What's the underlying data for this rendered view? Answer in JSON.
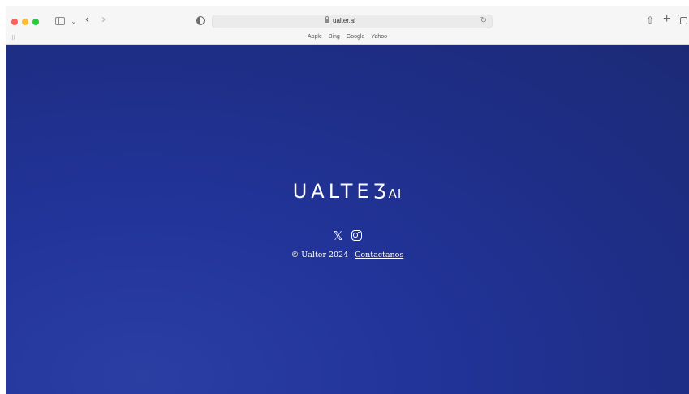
{
  "browser": {
    "url": "ualter.ai",
    "favorites": [
      "Apple",
      "Bing",
      "Google",
      "Yahoo"
    ],
    "icons": {
      "back": "‹",
      "forward": "›",
      "chevron": "⌄",
      "reload": "↻",
      "share": "⇧",
      "new_tab": "+",
      "grid": "⠿"
    }
  },
  "page": {
    "logo_text": "UALTE",
    "logo_mark": "Ʒ",
    "logo_suffix": "AI",
    "social": {
      "x_icon": "𝕏"
    },
    "copyright": "© Ualter 2024",
    "contact_link": "Contactanos",
    "background_color": "#1f2f8b"
  }
}
